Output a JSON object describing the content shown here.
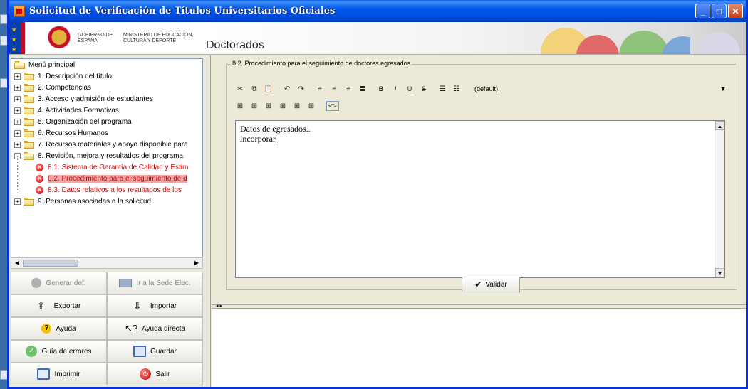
{
  "window": {
    "title": "Solicitud de Verificación de Títulos Universitarios Oficiales"
  },
  "banner": {
    "gov_label": "Gobierno de España",
    "ministry_label": "Ministerio de Educación, Cultura y Deporte",
    "page_title": "Doctorados"
  },
  "tree": {
    "root": "Menú principal",
    "items": [
      {
        "label": "1. Descripción del título"
      },
      {
        "label": "2. Competencias"
      },
      {
        "label": "3. Acceso y admisión de estudiantes"
      },
      {
        "label": "4. Actividades Formativas"
      },
      {
        "label": "5. Organización del programa"
      },
      {
        "label": "6. Recursos Humanos"
      },
      {
        "label": "7. Recursos materiales y apoyo disponible para"
      },
      {
        "label": "8. Revisión, mejora y resultados del programa"
      },
      {
        "label": "8.1. Sistema de Garantía de Calidad y Estim"
      },
      {
        "label": "8.2. Procedimiento para el seguimiento de d"
      },
      {
        "label": "8.3. Datos relativos a los resultados de los"
      },
      {
        "label": "9. Personas asociadas a la solicitud"
      }
    ]
  },
  "buttons": {
    "generar": "Generar def.",
    "sede": "Ir a la Sede Elec.",
    "exportar": "Exportar",
    "importar": "Importar",
    "ayuda": "Ayuda",
    "ayuda_directa": "Ayuda directa",
    "guia": "Guía de errores",
    "guardar": "Guardar",
    "imprimir": "Imprimir",
    "salir": "Salir"
  },
  "section": {
    "legend": "8.2. Procedimiento para el seguimiento de doctores egresados",
    "font_select": "(default)",
    "editor_lines": [
      "Datos de egresados..",
      "incorporar"
    ],
    "validar": "Validar"
  },
  "colors": {
    "title_blue": "#0058ee",
    "error_red": "#e00000",
    "selection": "#f4a7a7"
  }
}
